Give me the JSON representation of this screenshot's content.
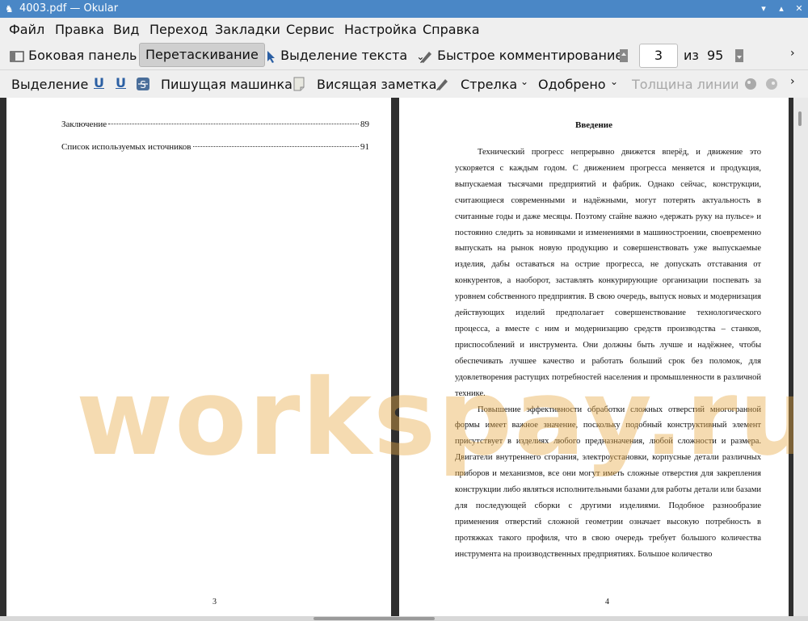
{
  "window": {
    "title": "4003.pdf  — Okular",
    "accent": "#4a87c6"
  },
  "menu": [
    "Файл",
    "Правка",
    "Вид",
    "Переход",
    "Закладки",
    "Сервис",
    "Настройка",
    "Справка"
  ],
  "toolbar1": {
    "sidebar_label": "Боковая панель",
    "drag_label": "Перетаскивание",
    "text_select_label": "Выделение текста",
    "quick_comment_label": "Быстрое комментирование",
    "page_current": "3",
    "page_of": "из",
    "page_total": "95"
  },
  "toolbar2": {
    "highlight_label": "Выделение",
    "typewriter_label": "Пишущая машинка",
    "sticky_note_label": "Висящая заметка",
    "arrow_label": "Стрелка",
    "stamp_label": "Одобрено",
    "line_width_label": "Толщина линии"
  },
  "left_page": {
    "toc": [
      {
        "title": "Заключение",
        "page": "89"
      },
      {
        "title": "Список используемых источников",
        "page": "91"
      }
    ],
    "page_number": "3"
  },
  "right_page": {
    "heading": "Введение",
    "paragraphs": [
      "Технический прогресс непрерывно движется вперёд, и движение это ускоряется с каждым годом. С движением прогресса меняется и продукция, выпускаемая тысячами предприятий и фабрик. Однако сейчас, конструкции, считающиеся современными и надёжными, могут потерять актуальность в считанные годы и даже месяцы. Поэтому crайне важно «держать руку на пульсе» и постоянно следить за новинками и изменениями в машиностроении, своевременно выпускать на рынок новую продукцию и совершенствовать уже выпускаемые изделия, дабы оставаться на острие прогресса, не допускать отставания от конкурентов, а наоборот, заставлять конкурирующие организации поспевать за уровнем собственного предприятия. В свою очередь, выпуск новых и модернизация действующих изделий предполагает совершенствование технологического процесса, а вместе с ним и модернизацию средств производства – станков, приспособлений и инструмента. Они должны быть лучше и надёжнее, чтобы обеспечивать лучшее качество и работать больший срок без поломок, для удовлетворения растущих потребностей населения и промышленности в различной технике.",
      "Повышение эффективности обработки сложных отверстий многогранной формы имеет важное значение, поскольку подобный конструктивный элемент присутствует в изделиях любого предназначения, любой сложности и размера. Двигатели внутреннего сгорания, электроустановки, корпусные детали различных приборов и механизмов, все они могут иметь сложные отверстия для закрепления конструкции либо являться исполнительными базами для работы детали или базами для последующей сборки с другими изделиями. Подобное разнообразие применения отверстий сложной геометрии означает высокую потребность в протяжках такого профиля, что в свою очередь требует большого количества инструмента на производственных предприятиях. Большое количество"
    ],
    "page_number": "4"
  },
  "watermark": "workspay.ru"
}
